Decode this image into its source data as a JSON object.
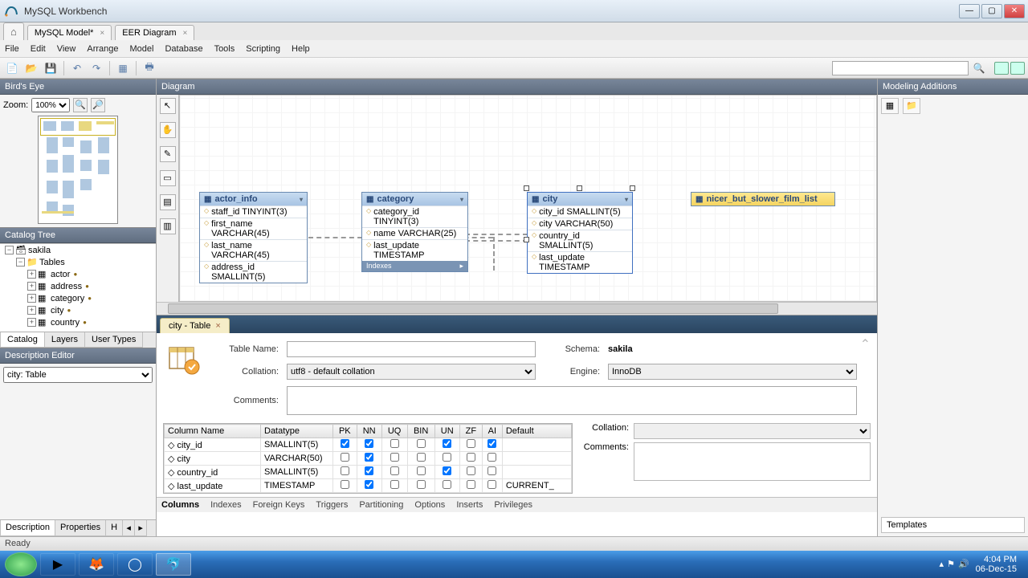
{
  "window": {
    "title": "MySQL Workbench"
  },
  "doc_tabs": [
    {
      "label": "",
      "home": true
    },
    {
      "label": "MySQL Model*",
      "closable": true
    },
    {
      "label": "EER Diagram",
      "closable": true
    }
  ],
  "menu": [
    "File",
    "Edit",
    "View",
    "Arrange",
    "Model",
    "Database",
    "Tools",
    "Scripting",
    "Help"
  ],
  "left": {
    "birds_eye": "Bird's Eye",
    "zoom_label": "Zoom:",
    "zoom_value": "100%",
    "catalog_tree": "Catalog Tree",
    "schema": "sakila",
    "tables_label": "Tables",
    "tables": [
      "actor",
      "address",
      "category",
      "city",
      "country"
    ],
    "left_tabs": [
      "Catalog",
      "Layers",
      "User Types"
    ],
    "desc_editor": "Description Editor",
    "desc_value": "city: Table",
    "bottom_tabs": [
      "Description",
      "Properties",
      "H"
    ]
  },
  "diagram": {
    "header": "Diagram",
    "tables": {
      "actor_info": {
        "name": "actor_info",
        "cols": [
          "staff_id TINYINT(3)",
          "first_name VARCHAR(45)",
          "last_name VARCHAR(45)",
          "address_id SMALLINT(5)"
        ]
      },
      "category": {
        "name": "category",
        "cols": [
          "category_id TINYINT(3)",
          "name VARCHAR(25)",
          "last_update TIMESTAMP"
        ],
        "indexes": "Indexes"
      },
      "city": {
        "name": "city",
        "cols": [
          "city_id SMALLINT(5)",
          "city VARCHAR(50)",
          "country_id SMALLINT(5)",
          "last_update TIMESTAMP"
        ]
      },
      "nicer": {
        "name": "nicer_but_slower_film_list"
      }
    }
  },
  "editor": {
    "tab": "city - Table",
    "table_name_label": "Table Name:",
    "table_name_value": "",
    "schema_label": "Schema:",
    "schema_value": "sakila",
    "collation_label": "Collation:",
    "collation_value": "utf8 - default collation",
    "engine_label": "Engine:",
    "engine_value": "InnoDB",
    "comments_label": "Comments:",
    "grid_headers": [
      "Column Name",
      "Datatype",
      "PK",
      "NN",
      "UQ",
      "BIN",
      "UN",
      "ZF",
      "AI",
      "Default"
    ],
    "columns": [
      {
        "name": "city_id",
        "type": "SMALLINT(5)",
        "pk": true,
        "nn": true,
        "uq": false,
        "bin": false,
        "un": true,
        "zf": false,
        "ai": true,
        "def": ""
      },
      {
        "name": "city",
        "type": "VARCHAR(50)",
        "pk": false,
        "nn": true,
        "uq": false,
        "bin": false,
        "un": false,
        "zf": false,
        "ai": false,
        "def": ""
      },
      {
        "name": "country_id",
        "type": "SMALLINT(5)",
        "pk": false,
        "nn": true,
        "uq": false,
        "bin": false,
        "un": true,
        "zf": false,
        "ai": false,
        "def": ""
      },
      {
        "name": "last_update",
        "type": "TIMESTAMP",
        "pk": false,
        "nn": true,
        "uq": false,
        "bin": false,
        "un": false,
        "zf": false,
        "ai": false,
        "def": "CURRENT_"
      }
    ],
    "side_collation": "Collation:",
    "side_comments": "Comments:",
    "bottom_tabs": [
      "Columns",
      "Indexes",
      "Foreign Keys",
      "Triggers",
      "Partitioning",
      "Options",
      "Inserts",
      "Privileges"
    ]
  },
  "right": {
    "header": "Modeling Additions",
    "templates": "Templates"
  },
  "status": "Ready",
  "tray": {
    "time": "4:04 PM",
    "date": "06-Dec-15"
  }
}
